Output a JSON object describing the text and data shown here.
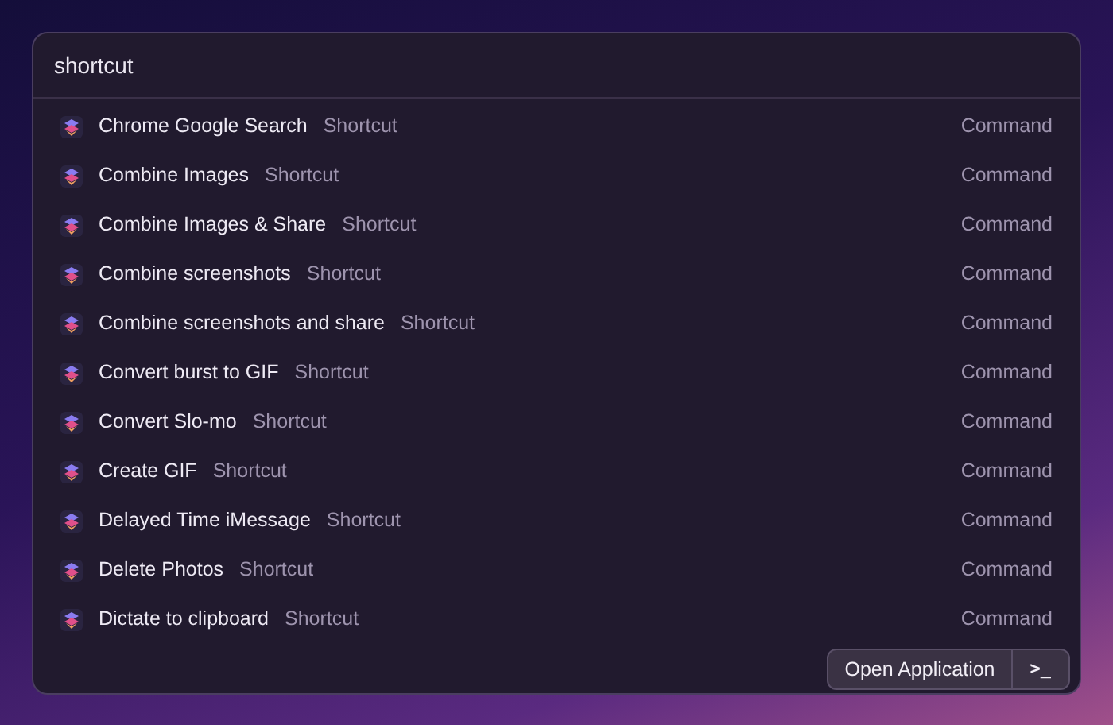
{
  "search": {
    "value": "shortcut"
  },
  "results": [
    {
      "title": "Chrome Google Search",
      "subtitle": "Shortcut",
      "accessory": "Command"
    },
    {
      "title": "Combine Images",
      "subtitle": "Shortcut",
      "accessory": "Command"
    },
    {
      "title": "Combine Images & Share",
      "subtitle": "Shortcut",
      "accessory": "Command"
    },
    {
      "title": "Combine screenshots",
      "subtitle": "Shortcut",
      "accessory": "Command"
    },
    {
      "title": "Combine screenshots and share",
      "subtitle": "Shortcut",
      "accessory": "Command"
    },
    {
      "title": "Convert burst to GIF",
      "subtitle": "Shortcut",
      "accessory": "Command"
    },
    {
      "title": "Convert Slo-mo",
      "subtitle": "Shortcut",
      "accessory": "Command"
    },
    {
      "title": "Create GIF",
      "subtitle": "Shortcut",
      "accessory": "Command"
    },
    {
      "title": "Delayed Time iMessage",
      "subtitle": "Shortcut",
      "accessory": "Command"
    },
    {
      "title": "Delete Photos",
      "subtitle": "Shortcut",
      "accessory": "Command"
    },
    {
      "title": "Dictate to clipboard",
      "subtitle": "Shortcut",
      "accessory": "Command"
    }
  ],
  "action_bar": {
    "primary": "Open Application",
    "secondary": ">_"
  }
}
